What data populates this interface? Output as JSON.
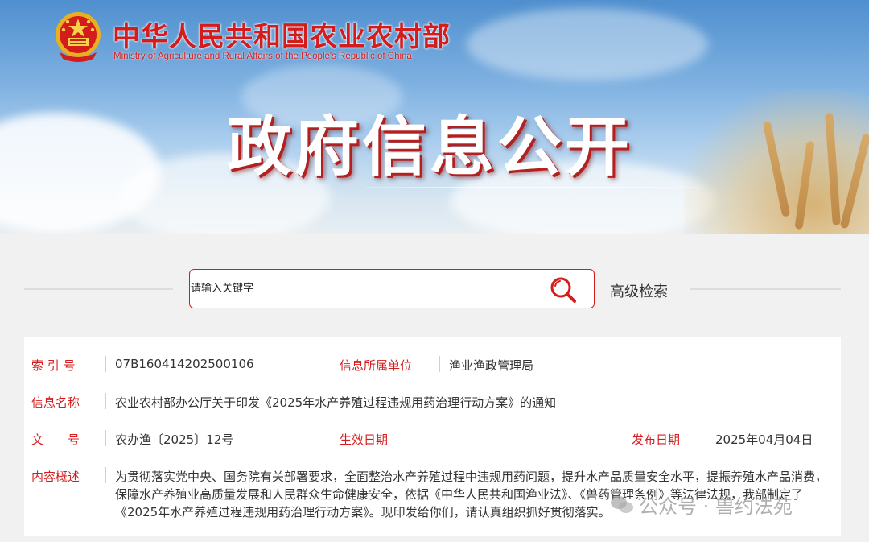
{
  "header": {
    "site_name_cn": "中华人民共和国农业农村部",
    "site_name_en": "Ministry of Agriculture and Rural Affairs of the People's Republic of China",
    "banner_title": "政府信息公开"
  },
  "search": {
    "placeholder": "请输入关键字",
    "advanced_label": "高级检索"
  },
  "info": {
    "index_label": "索 引 号",
    "index_value": "07B160414202500106",
    "unit_label": "信息所属单位",
    "unit_value": "渔业渔政管理局",
    "name_label": "信息名称",
    "name_value": "农业农村部办公厅关于印发《2025年水产养殖过程违规用药治理行动方案》的通知",
    "docno_label": "文　　号",
    "docno_value": "农办渔〔2025〕12号",
    "effective_label": "生效日期",
    "effective_value": "",
    "publish_label": "发布日期",
    "publish_value": "2025年04月04日",
    "summary_label": "内容概述",
    "summary_value": "为贯彻落实党中央、国务院有关部署要求，全面整治水产养殖过程中违规用药问题，提升水产品质量安全水平，提振养殖水产品消费，保障水产养殖业高质量发展和人民群众生命健康安全，依据《中华人民共和国渔业法》、《兽药管理条例》等法律法规，我部制定了《2025年水产养殖过程违规用药治理行动方案》。现印发给你们，请认真组织抓好贯彻落实。"
  },
  "watermark": {
    "text": "公众号 · 兽约法苑"
  },
  "colors": {
    "accent": "#d51c1c",
    "text": "#333333",
    "page_bg": "#f1f1f1"
  }
}
